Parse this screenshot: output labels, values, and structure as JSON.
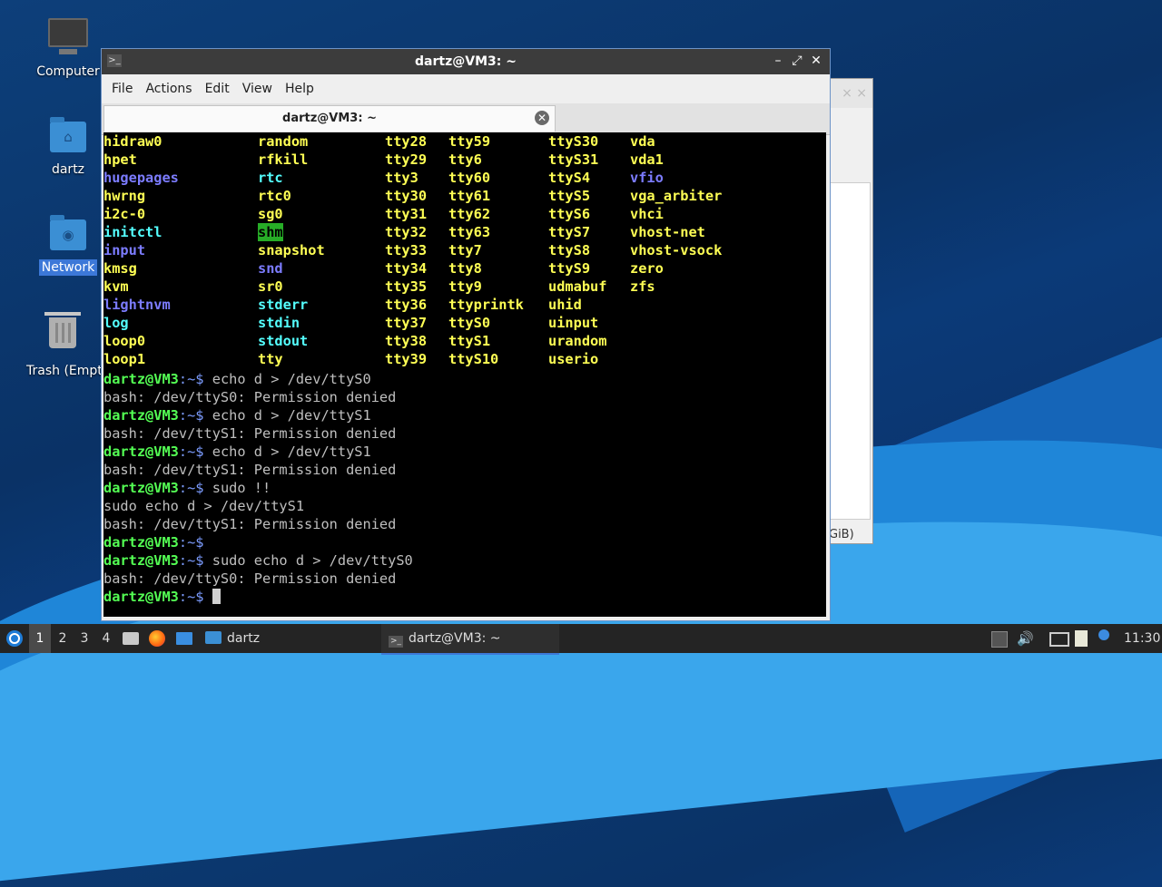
{
  "desktop": {
    "icons": [
      {
        "name": "computer",
        "label": "Computer"
      },
      {
        "name": "home",
        "label": "dartz"
      },
      {
        "name": "network",
        "label": "Network"
      },
      {
        "name": "trash",
        "label": "Trash (Empty)"
      }
    ]
  },
  "background_window": {
    "partial_text": "GiB)",
    "title_controls": "× ×"
  },
  "terminal": {
    "window_title": "dartz@VM3: ~",
    "controls": {
      "minimize": "–",
      "maximize": "⤢",
      "close": "✕"
    },
    "menu": [
      "File",
      "Actions",
      "Edit",
      "View",
      "Help"
    ],
    "tab": {
      "title": "dartz@VM3: ~",
      "close": "✕"
    },
    "listing": {
      "columns": [
        [
          {
            "t": "hidraw0",
            "c": "y"
          },
          {
            "t": "hpet",
            "c": "y"
          },
          {
            "t": "hugepages",
            "c": "b"
          },
          {
            "t": "hwrng",
            "c": "y"
          },
          {
            "t": "i2c-0",
            "c": "y"
          },
          {
            "t": "initctl",
            "c": "c"
          },
          {
            "t": "input",
            "c": "b"
          },
          {
            "t": "kmsg",
            "c": "y"
          },
          {
            "t": "kvm",
            "c": "y"
          },
          {
            "t": "lightnvm",
            "c": "b"
          },
          {
            "t": "log",
            "c": "c"
          },
          {
            "t": "loop0",
            "c": "y"
          },
          {
            "t": "loop1",
            "c": "y"
          }
        ],
        [
          {
            "t": "random",
            "c": "y"
          },
          {
            "t": "rfkill",
            "c": "y"
          },
          {
            "t": "rtc",
            "c": "c"
          },
          {
            "t": "rtc0",
            "c": "y"
          },
          {
            "t": "sg0",
            "c": "y"
          },
          {
            "t": "shm",
            "c": "g"
          },
          {
            "t": "snapshot",
            "c": "y"
          },
          {
            "t": "snd",
            "c": "b"
          },
          {
            "t": "sr0",
            "c": "y"
          },
          {
            "t": "stderr",
            "c": "c"
          },
          {
            "t": "stdin",
            "c": "c"
          },
          {
            "t": "stdout",
            "c": "c"
          },
          {
            "t": "tty",
            "c": "y"
          }
        ],
        [
          {
            "t": "tty28",
            "c": "y"
          },
          {
            "t": "tty29",
            "c": "y"
          },
          {
            "t": "tty3",
            "c": "y"
          },
          {
            "t": "tty30",
            "c": "y"
          },
          {
            "t": "tty31",
            "c": "y"
          },
          {
            "t": "tty32",
            "c": "y"
          },
          {
            "t": "tty33",
            "c": "y"
          },
          {
            "t": "tty34",
            "c": "y"
          },
          {
            "t": "tty35",
            "c": "y"
          },
          {
            "t": "tty36",
            "c": "y"
          },
          {
            "t": "tty37",
            "c": "y"
          },
          {
            "t": "tty38",
            "c": "y"
          },
          {
            "t": "tty39",
            "c": "y"
          }
        ],
        [
          {
            "t": "tty59",
            "c": "y"
          },
          {
            "t": "tty6",
            "c": "y"
          },
          {
            "t": "tty60",
            "c": "y"
          },
          {
            "t": "tty61",
            "c": "y"
          },
          {
            "t": "tty62",
            "c": "y"
          },
          {
            "t": "tty63",
            "c": "y"
          },
          {
            "t": "tty7",
            "c": "y"
          },
          {
            "t": "tty8",
            "c": "y"
          },
          {
            "t": "tty9",
            "c": "y"
          },
          {
            "t": "ttyprintk",
            "c": "y"
          },
          {
            "t": "ttyS0",
            "c": "y"
          },
          {
            "t": "ttyS1",
            "c": "y"
          },
          {
            "t": "ttyS10",
            "c": "y"
          }
        ],
        [
          {
            "t": "ttyS30",
            "c": "y"
          },
          {
            "t": "ttyS31",
            "c": "y"
          },
          {
            "t": "ttyS4",
            "c": "y"
          },
          {
            "t": "ttyS5",
            "c": "y"
          },
          {
            "t": "ttyS6",
            "c": "y"
          },
          {
            "t": "ttyS7",
            "c": "y"
          },
          {
            "t": "ttyS8",
            "c": "y"
          },
          {
            "t": "ttyS9",
            "c": "y"
          },
          {
            "t": "udmabuf",
            "c": "y"
          },
          {
            "t": "uhid",
            "c": "y"
          },
          {
            "t": "uinput",
            "c": "y"
          },
          {
            "t": "urandom",
            "c": "y"
          },
          {
            "t": "userio",
            "c": "y"
          }
        ],
        [
          {
            "t": "vda",
            "c": "y"
          },
          {
            "t": "vda1",
            "c": "y"
          },
          {
            "t": "vfio",
            "c": "b"
          },
          {
            "t": "vga_arbiter",
            "c": "y"
          },
          {
            "t": "vhci",
            "c": "y"
          },
          {
            "t": "vhost-net",
            "c": "y"
          },
          {
            "t": "vhost-vsock",
            "c": "y"
          },
          {
            "t": "zero",
            "c": "y"
          },
          {
            "t": "zfs",
            "c": "y"
          }
        ]
      ]
    },
    "session": [
      {
        "prompt": "dartz@VM3:~$",
        "text": " echo d > /dev/ttyS0"
      },
      {
        "prompt": "",
        "text": "bash: /dev/ttyS0: Permission denied"
      },
      {
        "prompt": "dartz@VM3:~$",
        "text": " echo d > /dev/ttyS1"
      },
      {
        "prompt": "",
        "text": "bash: /dev/ttyS1: Permission denied"
      },
      {
        "prompt": "dartz@VM3:~$",
        "text": " echo d > /dev/ttyS1"
      },
      {
        "prompt": "",
        "text": "bash: /dev/ttyS1: Permission denied"
      },
      {
        "prompt": "dartz@VM3:~$",
        "text": " sudo !!"
      },
      {
        "prompt": "",
        "text": "sudo echo d > /dev/ttyS1"
      },
      {
        "prompt": "",
        "text": "bash: /dev/ttyS1: Permission denied"
      },
      {
        "prompt": "dartz@VM3:~$",
        "text": ""
      },
      {
        "prompt": "dartz@VM3:~$",
        "text": " sudo echo d > /dev/ttyS0"
      },
      {
        "prompt": "",
        "text": "bash: /dev/ttyS0: Permission denied"
      },
      {
        "prompt": "dartz@VM3:~$",
        "text": " ",
        "cursor": true
      }
    ]
  },
  "taskbar": {
    "workspaces": [
      "1",
      "2",
      "3",
      "4"
    ],
    "active_workspace": "1",
    "folder_task": "dartz",
    "terminal_task": "dartz@VM3: ~",
    "clock": "11:30"
  },
  "colors": {
    "yellow": "#ffff54",
    "blue": "#7c7cff",
    "cyan": "#54ffff",
    "green_prompt": "#54ff54",
    "highlight": "#27ad27",
    "selection": "#3c78d8"
  }
}
